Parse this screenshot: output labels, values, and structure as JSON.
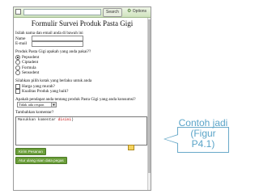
{
  "toolbar": {
    "search_label": "Search",
    "options_label": "Options",
    "search_value": ""
  },
  "form": {
    "title": "Formulir Survei Produk Pasta Gigi",
    "intro": "Isilah nama dan email anda di bawah ini",
    "name_label": "Name",
    "email_label": "E-mail",
    "q1": "Produk Pasta Gigi apakah yang anda pakai??",
    "q1_options": [
      "Pepsodent",
      "Ciptadent",
      "Formula",
      "Sensodent"
    ],
    "q1_selected": 0,
    "q2": "Silahkan pilih kotak yang berlaku untuk anda",
    "q2_options": [
      "Harga yang murah?",
      "Kualitas Produk yang baik?"
    ],
    "q3": "Apakah pendapat anda tentang produk Pasta Gigi yang anda konsumsi?",
    "q3_select_value": "Tidak ada respon",
    "q4": "Tambahkan komentar?",
    "comment_prefix": "Masukkan komentar ",
    "comment_highlight": "disini",
    "comment_suffix": ")",
    "submit_label": "Kirim Pesanan",
    "reset_label": "Atur ulang isian data pegas"
  },
  "callout": {
    "text": "Contoh jadi\n(Figur\nP4.1)"
  }
}
